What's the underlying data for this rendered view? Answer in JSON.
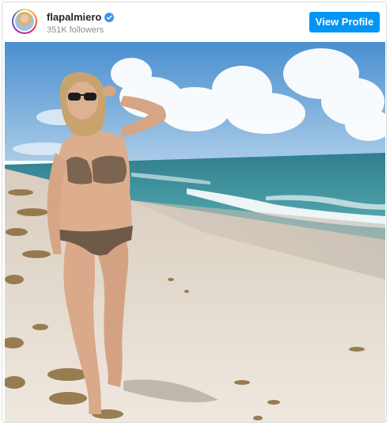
{
  "post": {
    "username": "flapalmiero",
    "followers": "351K followers",
    "verified": true,
    "view_profile_label": "View Profile"
  },
  "icons": {
    "verified": "verified-badge-icon"
  },
  "colors": {
    "button": "#0095f6",
    "verified": "#3897f0",
    "sky": "#5a9fd6",
    "sea": "#3d8d9a",
    "sand": "#e8dfd3"
  }
}
